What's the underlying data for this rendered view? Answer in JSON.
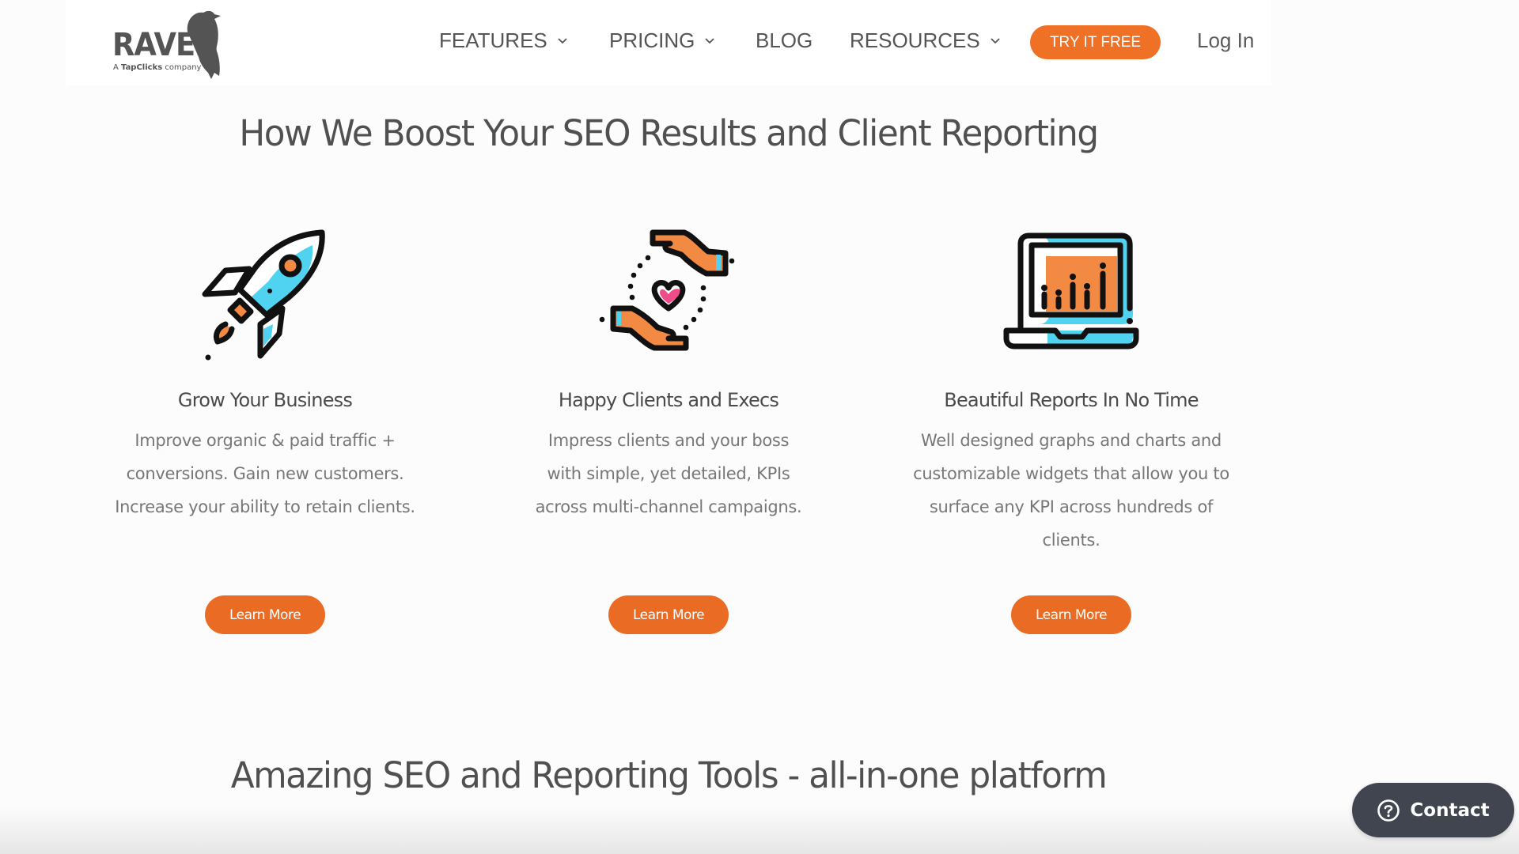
{
  "brand": {
    "logo_word": "RAVEN",
    "logo_sub_prefix": "A ",
    "logo_sub_brand": "TapClicks",
    "logo_sub_suffix": " company"
  },
  "nav": {
    "items": [
      {
        "label": "FEATURES",
        "icon": "chevron-down-icon"
      },
      {
        "label": "PRICING",
        "icon": "chevron-down-icon"
      },
      {
        "label": "BLOG"
      },
      {
        "label": "RESOURCES",
        "icon": "chevron-down-icon"
      }
    ],
    "cta_label": "TRY IT FREE",
    "login_label": "Log In"
  },
  "colors": {
    "accent": "#ee7125",
    "text_dark": "#505050",
    "text_muted": "#777777",
    "contact_bg": "#404550",
    "icon_cyan": "#4fd3f0",
    "icon_orange": "#f28a44",
    "icon_pink": "#ee4d8a"
  },
  "section1": {
    "title": "How We Boost Your SEO Results and Client Reporting",
    "cards": [
      {
        "icon": "rocket-icon",
        "title": "Grow Your Business",
        "body": "Improve organic & paid traffic + conversions. Gain new customers. Increase your ability to retain clients.",
        "button": "Learn More"
      },
      {
        "icon": "hands-heart-icon",
        "title": "Happy Clients and Execs",
        "body": "Impress clients and your boss with simple, yet detailed, KPIs across multi-channel campaigns.",
        "button": "Learn More"
      },
      {
        "icon": "laptop-chart-icon",
        "title": "Beautiful Reports In No Time",
        "body": "Well designed graphs and charts and customizable widgets that allow you to surface any KPI across hundreds of clients.",
        "button": "Learn More"
      }
    ]
  },
  "section2": {
    "title": "Amazing SEO and Reporting Tools - all-in-one platform"
  },
  "contact": {
    "label": "Contact",
    "icon": "question-circle-icon"
  }
}
